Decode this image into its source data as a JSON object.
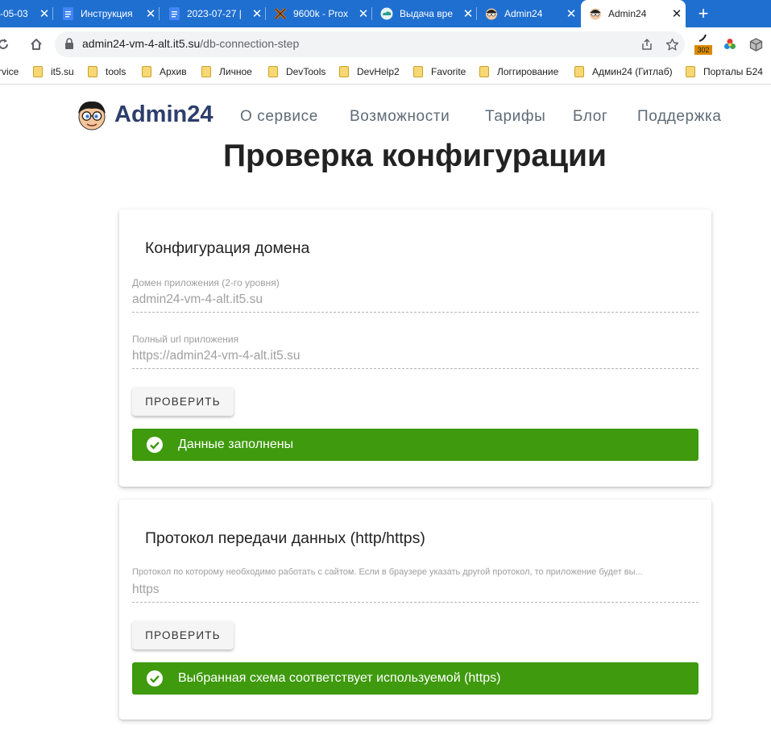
{
  "browser": {
    "tabs": [
      {
        "title": "-05-03"
      },
      {
        "title": "Инструкция"
      },
      {
        "title": "2023-07-27 |"
      },
      {
        "title": "9600k - Prox"
      },
      {
        "title": "Выдача вре"
      },
      {
        "title": "Admin24"
      },
      {
        "title": "Admin24"
      }
    ],
    "address": {
      "host": "admin24-vm-4-alt.it5.su",
      "path": "/db-connection-step"
    },
    "extension_badge": "302",
    "bookmarks": [
      "rvice",
      "it5.su",
      "tools",
      "Архив",
      "Личное",
      "DevTools",
      "DevHelp2",
      "Favorite",
      "Логгирование",
      "Админ24 (Гитлаб)",
      "Порталы Б24"
    ]
  },
  "site": {
    "logo_text": "Admin24",
    "nav": [
      "О сервисе",
      "Возможности",
      "Тарифы",
      "Блог",
      "Поддержка"
    ]
  },
  "page": {
    "title": "Проверка конфигурации",
    "domain_card": {
      "title": "Конфигурация домена",
      "app_domain_label": "Домен приложения (2-го уровня)",
      "app_domain_value": "admin24-vm-4-alt.it5.su",
      "app_url_label": "Полный url приложения",
      "app_url_value": "https://admin24-vm-4-alt.it5.su",
      "check_button": "ПРОВЕРИТЬ",
      "status": "Данные заполнены"
    },
    "protocol_card": {
      "title": "Протокол передачи данных (http/https)",
      "protocol_label": "Протокол по которому необходимо работать с сайтом. Если в браузере указать другой протокол, то приложение будет вы...",
      "protocol_value": "https",
      "check_button": "ПРОВЕРИТЬ",
      "status": "Выбранная схема соответствует используемой (https)"
    }
  },
  "colors": {
    "tab_strip": "#1f6fd1",
    "success": "#3f9a0e",
    "logo": "#2c3e6b"
  }
}
